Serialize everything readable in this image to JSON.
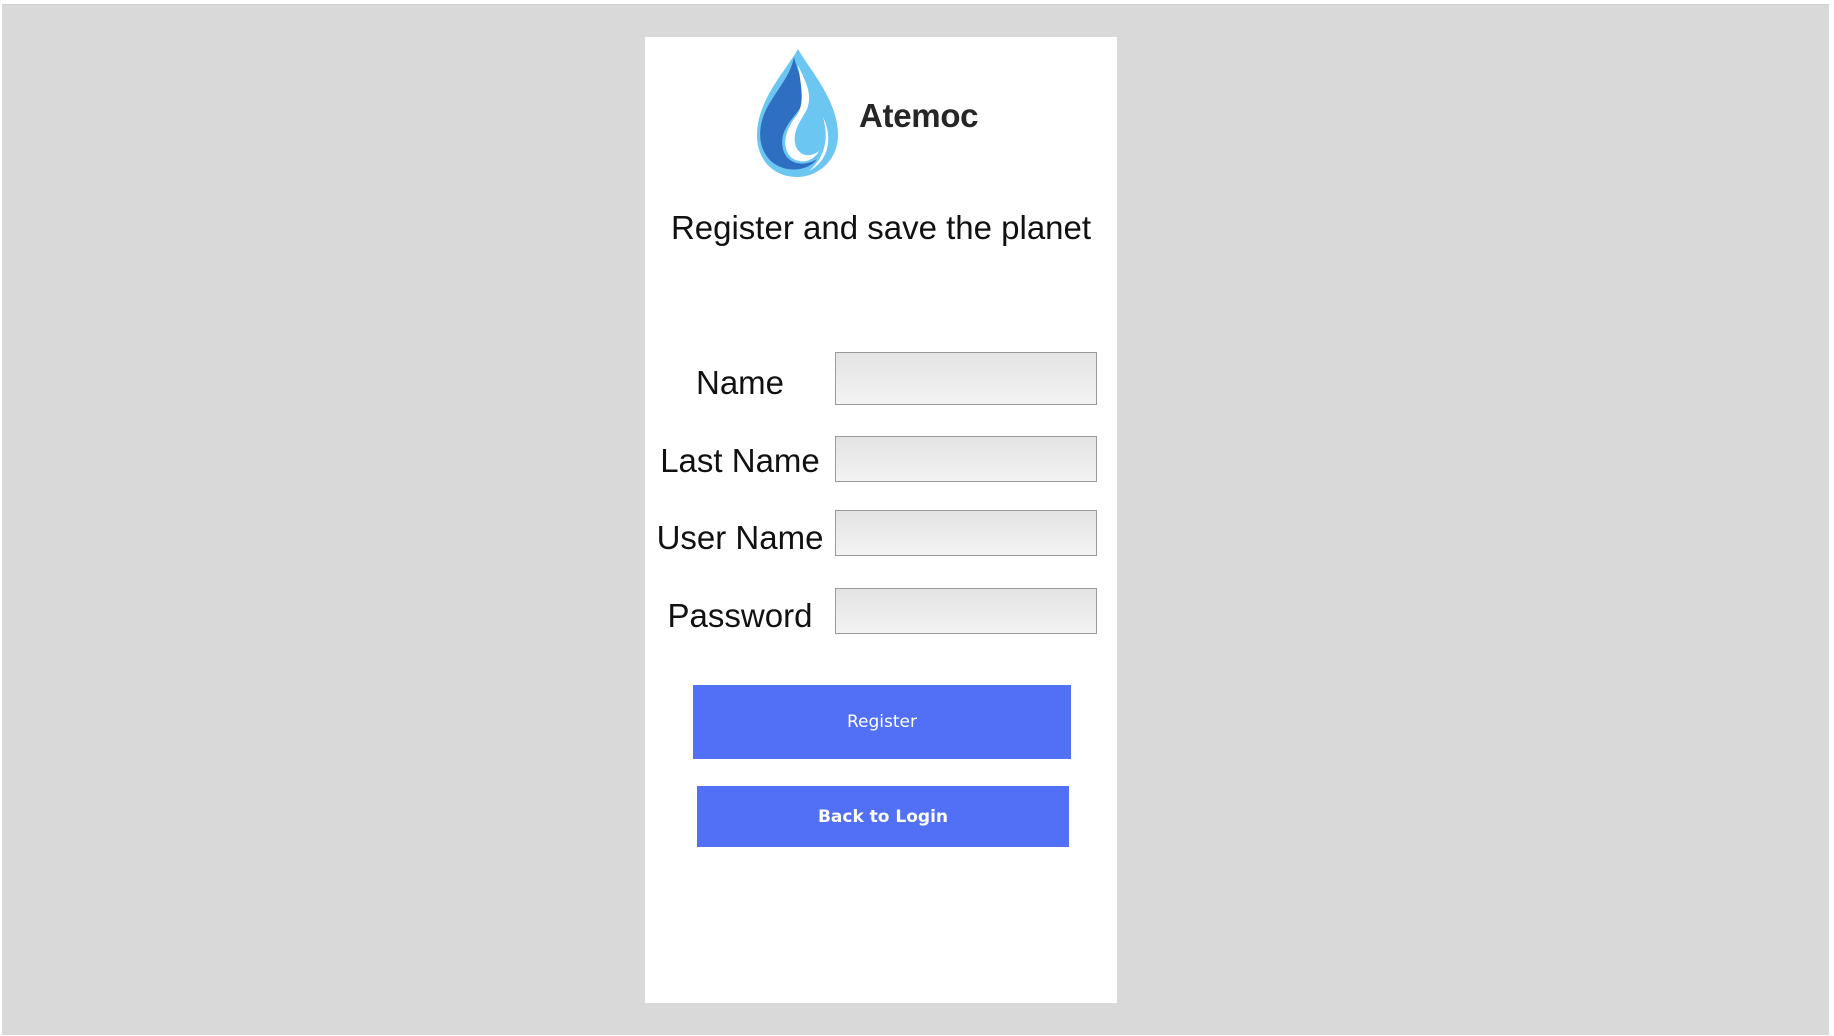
{
  "app": {
    "brand_name": "Atemoc",
    "logo_icon": "water-drop-icon",
    "colors": {
      "background": "#d9d9d9",
      "card": "#ffffff",
      "button": "#5270f5",
      "drop_dark": "#2f6fc2",
      "drop_light": "#6cc6f2"
    }
  },
  "form": {
    "tagline": "Register and save the planet",
    "fields": [
      {
        "label": "Name",
        "value": "",
        "placeholder": ""
      },
      {
        "label": "Last Name",
        "value": "",
        "placeholder": ""
      },
      {
        "label": "User Name",
        "value": "",
        "placeholder": ""
      },
      {
        "label": "Password",
        "value": "",
        "placeholder": ""
      }
    ],
    "register_label": "Register",
    "back_label": "Back to Login"
  }
}
